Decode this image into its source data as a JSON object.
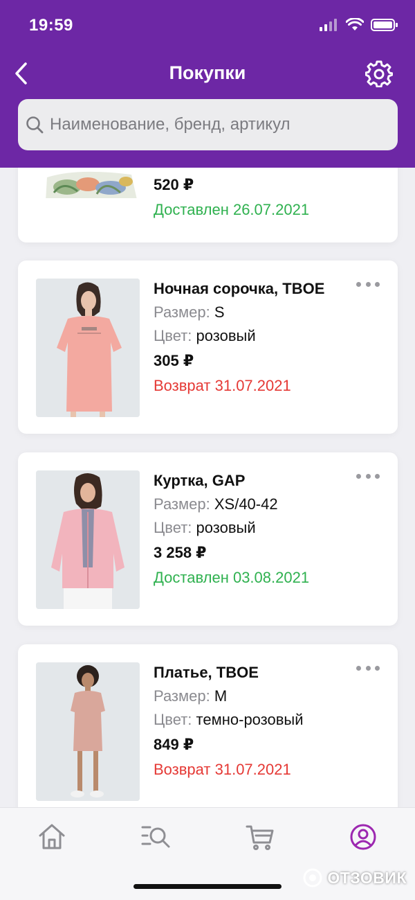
{
  "status_bar": {
    "time": "19:59"
  },
  "nav": {
    "title": "Покупки"
  },
  "search": {
    "placeholder": "Наименование, бренд, артикул"
  },
  "purchases": [
    {
      "price": "520 ₽",
      "status": "Доставлен 26.07.2021",
      "status_type": "delivered"
    },
    {
      "title": "Ночная сорочка, TBOE",
      "size_label": "Размер:",
      "size": "S",
      "color_label": "Цвет:",
      "color": "розовый",
      "price": "305 ₽",
      "status": "Возврат 31.07.2021",
      "status_type": "returned"
    },
    {
      "title": "Куртка, GAP",
      "size_label": "Размер:",
      "size": "XS/40-42",
      "color_label": "Цвет:",
      "color": "розовый",
      "price": "3 258 ₽",
      "status": "Доставлен 03.08.2021",
      "status_type": "delivered"
    },
    {
      "title": "Платье, TBOE",
      "size_label": "Размер:",
      "size": "M",
      "color_label": "Цвет:",
      "color": "темно-розовый",
      "price": "849 ₽",
      "status": "Возврат 31.07.2021",
      "status_type": "returned"
    }
  ],
  "tabbar": {
    "tabs": [
      {
        "icon": "home-icon",
        "active": false
      },
      {
        "icon": "catalog-search-icon",
        "active": false
      },
      {
        "icon": "cart-icon",
        "active": false
      },
      {
        "icon": "profile-icon",
        "active": true
      }
    ],
    "active_color": "#9c27b0",
    "inactive_color": "#8e8e93"
  },
  "watermark": {
    "text": "ОТЗОВИК"
  },
  "colors": {
    "header": "#6d27a5",
    "delivered": "#2fb14f",
    "returned": "#e53935"
  }
}
